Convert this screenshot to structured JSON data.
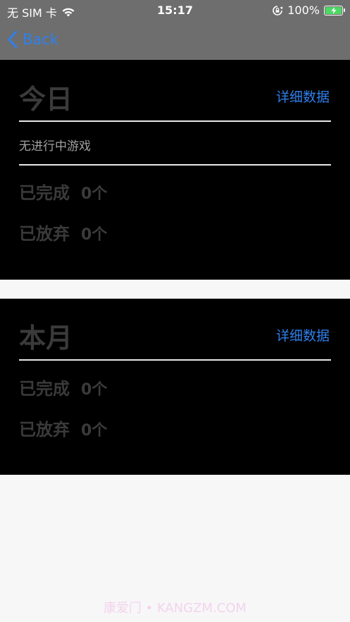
{
  "status_bar": {
    "carrier": "无 SIM 卡",
    "time": "15:17",
    "battery": "100%"
  },
  "nav": {
    "back_label": "Back"
  },
  "today": {
    "title": "今日",
    "detail_label": "详细数据",
    "empty_text": "无进行中游戏",
    "completed_label": "已完成",
    "completed_value": "0个",
    "abandoned_label": "已放弃",
    "abandoned_value": "0个"
  },
  "month": {
    "title": "本月",
    "detail_label": "详细数据",
    "completed_label": "已完成",
    "completed_value": "0个",
    "abandoned_label": "已放弃",
    "abandoned_value": "0个"
  },
  "watermark": "康爱门 • KANGZM.COM",
  "colors": {
    "accent": "#2f80ed",
    "card_bg": "#000000",
    "bar_bg": "#6e6e6e",
    "page_bg": "#f7f7f7",
    "battery_fill": "#4cd964"
  }
}
